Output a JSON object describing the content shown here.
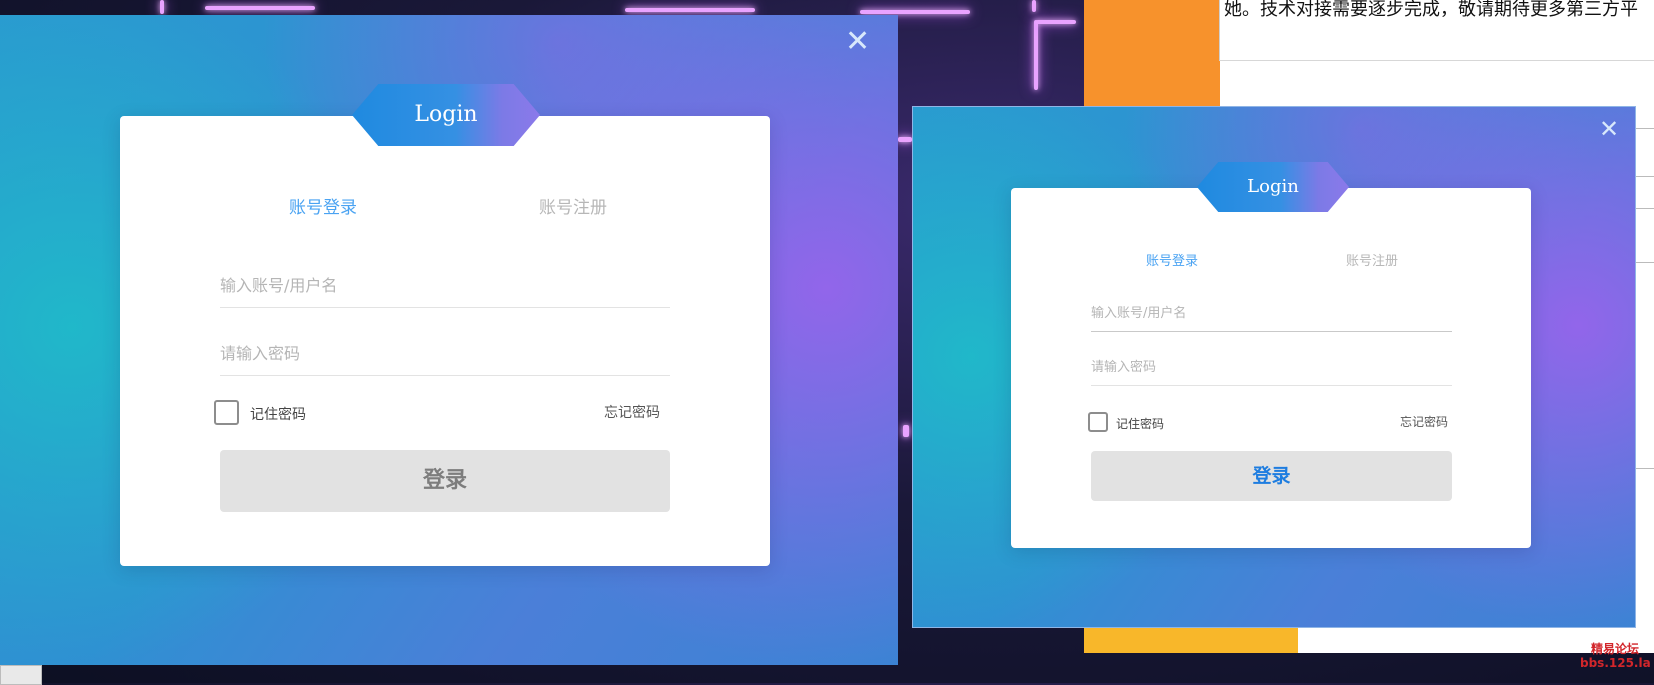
{
  "background_app": {
    "text_line": "她。技术对接需要逐步完成，敬请期待更多第三方平",
    "watermark": [
      "精易论坛",
      "bbs.125.la"
    ]
  },
  "colors": {
    "accent": "#4aa3f2",
    "orange": "#f7922c",
    "yellow": "#f8b72a",
    "button_bg": "#e2e2e2",
    "button_text_large": "#7d7d7d",
    "button_text_small": "#1e7de0"
  },
  "windows": [
    {
      "badge": "Login",
      "close_icon": "✕",
      "tabs": {
        "login": "账号登录",
        "register": "账号注册"
      },
      "username_placeholder": "输入账号/用户名",
      "password_placeholder": "请输入密码",
      "remember_label": "记住密码",
      "remember_checked": false,
      "forgot_label": "忘记密码",
      "submit_label": "登录"
    },
    {
      "badge": "Login",
      "close_icon": "✕",
      "tabs": {
        "login": "账号登录",
        "register": "账号注册"
      },
      "username_placeholder": "输入账号/用户名",
      "password_placeholder": "请输入密码",
      "remember_label": "记住密码",
      "remember_checked": false,
      "forgot_label": "忘记密码",
      "submit_label": "登录"
    }
  ]
}
